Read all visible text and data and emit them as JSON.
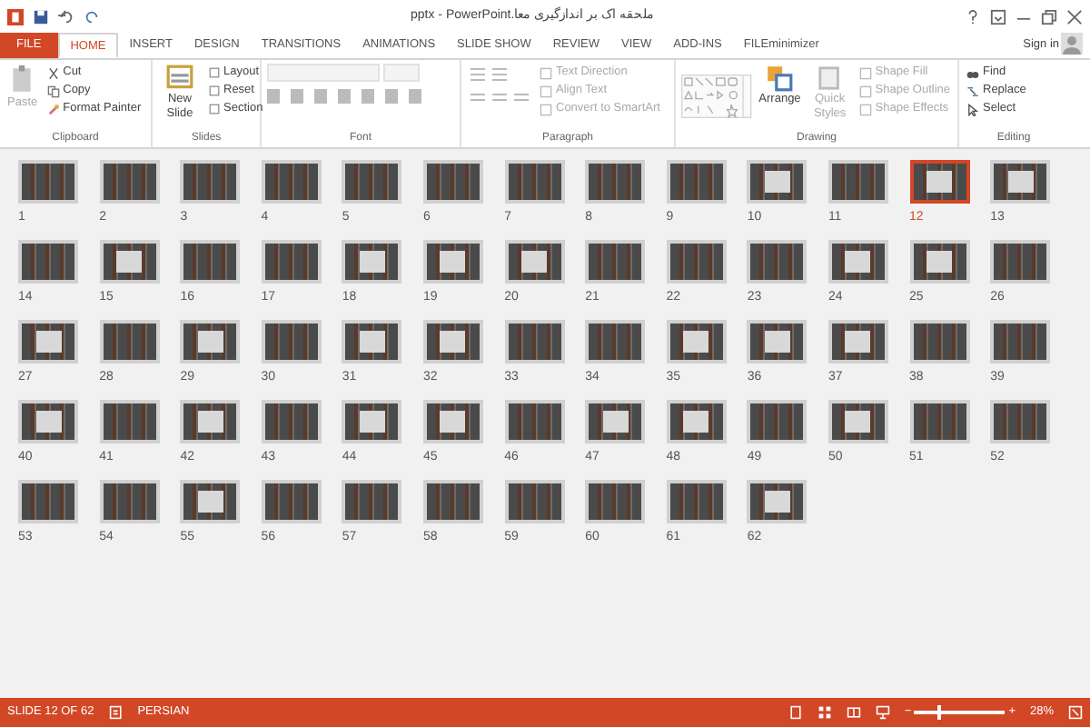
{
  "window": {
    "title": "ملحقه اک بر اندازگیری معا.pptx - PowerPoint",
    "sign_in": "Sign in"
  },
  "tabs": [
    {
      "label": "FILE",
      "kind": "file",
      "selected": false
    },
    {
      "label": "HOME",
      "kind": "tab",
      "selected": true
    },
    {
      "label": "INSERT",
      "kind": "tab",
      "selected": false
    },
    {
      "label": "DESIGN",
      "kind": "tab",
      "selected": false
    },
    {
      "label": "TRANSITIONS",
      "kind": "tab",
      "selected": false
    },
    {
      "label": "ANIMATIONS",
      "kind": "tab",
      "selected": false
    },
    {
      "label": "SLIDE SHOW",
      "kind": "tab",
      "selected": false
    },
    {
      "label": "REVIEW",
      "kind": "tab",
      "selected": false
    },
    {
      "label": "VIEW",
      "kind": "tab",
      "selected": false
    },
    {
      "label": "ADD-INS",
      "kind": "tab",
      "selected": false
    },
    {
      "label": "FILEminimizer",
      "kind": "tab",
      "selected": false
    }
  ],
  "ribbon": {
    "clipboard": {
      "label": "Clipboard",
      "paste": {
        "label": "Paste",
        "disabled": true
      },
      "items": [
        {
          "label": "Cut",
          "disabled": false
        },
        {
          "label": "Copy",
          "disabled": false
        },
        {
          "label": "Format Painter",
          "disabled": false
        }
      ]
    },
    "slides": {
      "label": "Slides",
      "new_slide": "New Slide",
      "items": [
        {
          "label": "Layout",
          "disabled": false
        },
        {
          "label": "Reset",
          "disabled": false
        },
        {
          "label": "Section",
          "disabled": false
        }
      ]
    },
    "font": {
      "label": "Font",
      "disabled": true
    },
    "paragraph": {
      "label": "Paragraph",
      "items": [
        {
          "label": "Text Direction",
          "disabled": true
        },
        {
          "label": "Align Text",
          "disabled": true
        },
        {
          "label": "Convert to SmartArt",
          "disabled": true
        }
      ]
    },
    "drawing": {
      "label": "Drawing",
      "arrange": "Arrange",
      "quick_styles": "Quick Styles",
      "items": [
        {
          "label": "Shape Fill",
          "disabled": true
        },
        {
          "label": "Shape Outline",
          "disabled": true
        },
        {
          "label": "Shape Effects",
          "disabled": true
        }
      ]
    },
    "editing": {
      "label": "Editing",
      "items": [
        {
          "label": "Find",
          "disabled": false
        },
        {
          "label": "Replace",
          "disabled": false
        },
        {
          "label": "Select",
          "disabled": false
        }
      ]
    }
  },
  "slides": [
    {
      "number": "1",
      "kind": "text",
      "selected": false
    },
    {
      "number": "2",
      "kind": "text",
      "selected": false
    },
    {
      "number": "3",
      "kind": "text",
      "selected": false
    },
    {
      "number": "4",
      "kind": "text",
      "selected": false
    },
    {
      "number": "5",
      "kind": "text",
      "selected": false
    },
    {
      "number": "6",
      "kind": "text",
      "selected": false
    },
    {
      "number": "7",
      "kind": "text",
      "selected": false
    },
    {
      "number": "8",
      "kind": "text",
      "selected": false
    },
    {
      "number": "9",
      "kind": "text",
      "selected": false
    },
    {
      "number": "10",
      "kind": "picture",
      "selected": false
    },
    {
      "number": "11",
      "kind": "text",
      "selected": false
    },
    {
      "number": "12",
      "kind": "picture",
      "selected": true
    },
    {
      "number": "13",
      "kind": "picture",
      "selected": false
    },
    {
      "number": "14",
      "kind": "text",
      "selected": false
    },
    {
      "number": "15",
      "kind": "picture",
      "selected": false
    },
    {
      "number": "16",
      "kind": "text",
      "selected": false
    },
    {
      "number": "17",
      "kind": "text",
      "selected": false
    },
    {
      "number": "18",
      "kind": "picture",
      "selected": false
    },
    {
      "number": "19",
      "kind": "picture",
      "selected": false
    },
    {
      "number": "20",
      "kind": "picture",
      "selected": false
    },
    {
      "number": "21",
      "kind": "text",
      "selected": false
    },
    {
      "number": "22",
      "kind": "text",
      "selected": false
    },
    {
      "number": "23",
      "kind": "text",
      "selected": false
    },
    {
      "number": "24",
      "kind": "picture",
      "selected": false
    },
    {
      "number": "25",
      "kind": "picture",
      "selected": false
    },
    {
      "number": "26",
      "kind": "text",
      "selected": false
    },
    {
      "number": "27",
      "kind": "picture",
      "selected": false
    },
    {
      "number": "28",
      "kind": "text",
      "selected": false
    },
    {
      "number": "29",
      "kind": "picture",
      "selected": false
    },
    {
      "number": "30",
      "kind": "text",
      "selected": false
    },
    {
      "number": "31",
      "kind": "picture",
      "selected": false
    },
    {
      "number": "32",
      "kind": "picture",
      "selected": false
    },
    {
      "number": "33",
      "kind": "text",
      "selected": false
    },
    {
      "number": "34",
      "kind": "text",
      "selected": false
    },
    {
      "number": "35",
      "kind": "picture",
      "selected": false
    },
    {
      "number": "36",
      "kind": "picture",
      "selected": false
    },
    {
      "number": "37",
      "kind": "picture",
      "selected": false
    },
    {
      "number": "38",
      "kind": "text",
      "selected": false
    },
    {
      "number": "39",
      "kind": "text",
      "selected": false
    },
    {
      "number": "40",
      "kind": "picture",
      "selected": false
    },
    {
      "number": "41",
      "kind": "text",
      "selected": false
    },
    {
      "number": "42",
      "kind": "picture",
      "selected": false
    },
    {
      "number": "43",
      "kind": "text",
      "selected": false
    },
    {
      "number": "44",
      "kind": "picture",
      "selected": false
    },
    {
      "number": "45",
      "kind": "picture",
      "selected": false
    },
    {
      "number": "46",
      "kind": "text",
      "selected": false
    },
    {
      "number": "47",
      "kind": "picture",
      "selected": false
    },
    {
      "number": "48",
      "kind": "picture",
      "selected": false
    },
    {
      "number": "49",
      "kind": "text",
      "selected": false
    },
    {
      "number": "50",
      "kind": "picture",
      "selected": false
    },
    {
      "number": "51",
      "kind": "text",
      "selected": false
    },
    {
      "number": "52",
      "kind": "text",
      "selected": false
    },
    {
      "number": "53",
      "kind": "text",
      "selected": false
    },
    {
      "number": "54",
      "kind": "text",
      "selected": false
    },
    {
      "number": "55",
      "kind": "picture",
      "selected": false
    },
    {
      "number": "56",
      "kind": "text",
      "selected": false
    },
    {
      "number": "57",
      "kind": "text",
      "selected": false
    },
    {
      "number": "58",
      "kind": "text",
      "selected": false
    },
    {
      "number": "59",
      "kind": "text",
      "selected": false
    },
    {
      "number": "60",
      "kind": "text",
      "selected": false
    },
    {
      "number": "61",
      "kind": "text",
      "selected": false
    },
    {
      "number": "62",
      "kind": "picture",
      "selected": false
    }
  ],
  "status_bar": {
    "slide_info": "SLIDE 12 OF 62",
    "language": "PERSIAN",
    "zoom": {
      "label": "28%",
      "level": 0.28,
      "zoom_out": "−",
      "zoom_in": "+"
    }
  }
}
